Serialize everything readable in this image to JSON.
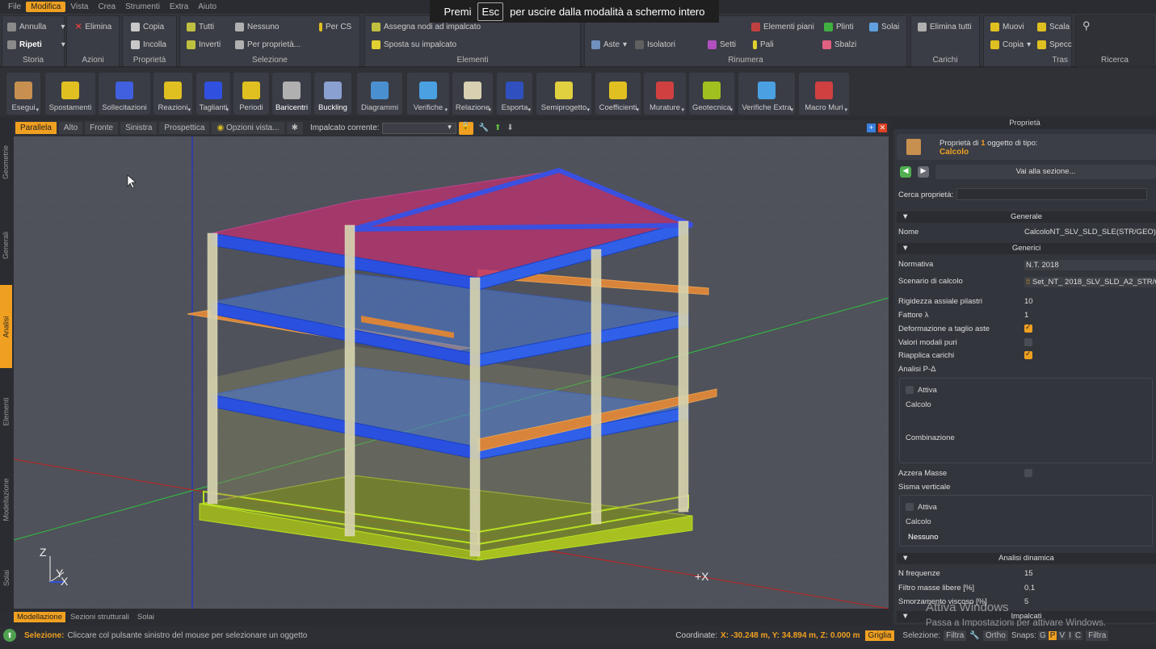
{
  "menubar": [
    "File",
    "Modifica",
    "Vista",
    "Crea",
    "Strumenti",
    "Extra",
    "Aiuto"
  ],
  "toast": {
    "pre": "Premi",
    "key": "Esc",
    "post": "per uscire dalla modalità a schermo intero"
  },
  "ribbon": {
    "storia": {
      "title": "Storia",
      "annulla": "Annulla",
      "ripeti": "Ripeti"
    },
    "azioni": {
      "title": "Azioni",
      "elimina": "Elimina"
    },
    "proprieta": {
      "title": "Proprietà",
      "copia": "Copia",
      "incolla": "Incolla"
    },
    "selezione": {
      "title": "Selezione",
      "tutti": "Tutti",
      "nessuno": "Nessuno",
      "percs": "Per CS",
      "inverti": "Inverti",
      "perprop": "Per proprietà..."
    },
    "elementi": {
      "title": "Elementi",
      "assegna": "Assegna nodi ad impalcato",
      "sposta": "Sposta su impalcato"
    },
    "rinumera": {
      "title": "Rinumera",
      "aste": "Aste",
      "isolatori": "Isolatori",
      "setti": "Setti",
      "pali": "Pali",
      "elpiani": "Elementi piani",
      "plinti": "Plinti",
      "solai": "Solai",
      "sbalzi": "Sbalzi"
    },
    "carichi": {
      "title": "Carichi",
      "elimina": "Elimina tutti"
    },
    "tras": {
      "title": "Tras",
      "muovi": "Muovi",
      "scala": "Scala",
      "copia": "Copia",
      "specc": "Specc"
    },
    "ricerca": {
      "title": "Ricerca"
    }
  },
  "toolbar": [
    "Esegui",
    "Spostamenti",
    "Sollecitazioni",
    "Reazioni",
    "Taglianti",
    "Periodi",
    "Baricentri",
    "Buckling",
    "Diagrammi",
    "Verifiche",
    "Relazione",
    "Esporta",
    "Semiprogetto",
    "Coefficienti",
    "Murature",
    "Geotecnica",
    "Verifiche Extra",
    "Macro Muri"
  ],
  "lefttabs": [
    "Geometrie",
    "Generali",
    "Analisi",
    "Elementi",
    "Modellazione",
    "Solai"
  ],
  "viewtabs": {
    "tabs": [
      "Parallela",
      "Alto",
      "Fronte",
      "Sinistra",
      "Prospettica"
    ],
    "opzioni": "Opzioni vista...",
    "impalcato": "Impalcato corrente:"
  },
  "viewport": {
    "axis_z": "Z",
    "axis_y": "Y",
    "axis_x": "X",
    "plus_x": "+X"
  },
  "bottomtabs": [
    "Modellazione",
    "Sezioni strutturali",
    "Solai"
  ],
  "status": {
    "label": "Selezione:",
    "text": "Cliccare col pulsante sinistro del mouse per selezionare un oggetto",
    "coord_label": "Coordinate:",
    "coord_val": "X: -30.248 m, Y: 34.894 m, Z: 0.000 m",
    "griglia": "Griglia",
    "selezione": "Selezione:",
    "filtra": "Filtra",
    "ortho": "Ortho",
    "snaps": "Snaps:",
    "snap_keys": [
      "G",
      "P",
      "V",
      "I",
      "C"
    ],
    "filtra2": "Filtra"
  },
  "panel": {
    "title": "Proprietà",
    "header_line1": "Proprietà di",
    "header_count": "1",
    "header_line1b": "oggetto di tipo:",
    "header_type": "Calcolo",
    "vai": "Vai alla sezione...",
    "cerca": "Cerca proprietà:",
    "generale": "Generale",
    "nome_label": "Nome",
    "nome_val": "CalcoloNT_SLV_SLD_SLE(STR/GEO)",
    "generici": "Generici",
    "normativa_label": "Normativa",
    "normativa_val": "N.T. 2018",
    "scenario_label": "Scenario di calcolo",
    "scenario_val": "Set_NT_ 2018_SLV_SLD_A2_STR/GEO",
    "rig_label": "Rigidezza assiale pilastri",
    "rig_val": "10",
    "fattore_label": "Fattore λ",
    "fattore_val": "1",
    "deform_label": "Deformazione a taglio aste",
    "valori_label": "Valori modali puri",
    "riapplica_label": "Riapplica carichi",
    "pdelta_label": "Analisi P-Δ",
    "attiva1": "Attiva",
    "calcolo1": "Calcolo",
    "combinazione": "Combinazione",
    "azzera_label": "Azzera Masse",
    "sisma_label": "Sisma verticale",
    "attiva2": "Attiva",
    "calcolo2": "Calcolo",
    "nessuno": "Nessuno",
    "dinamica": "Analisi dinamica",
    "nfreq_label": "N frequenze",
    "nfreq_val": "15",
    "filtro_label": "Filtro masse libere [%]",
    "filtro_val": "0.1",
    "smorz_label": "Smorzamento viscoso [%]",
    "smorz_val": "5",
    "impalcati": "Impalcati"
  },
  "watermark": {
    "line1": "Attiva Windows",
    "line2": "Passa a Impostazioni per attivare Windows."
  },
  "colors": {
    "accent": "#f0a020",
    "roof": "#b0306a",
    "floor": "#3a6cf0",
    "balcony": "#e08a3a",
    "foundation": "#b8e020"
  }
}
